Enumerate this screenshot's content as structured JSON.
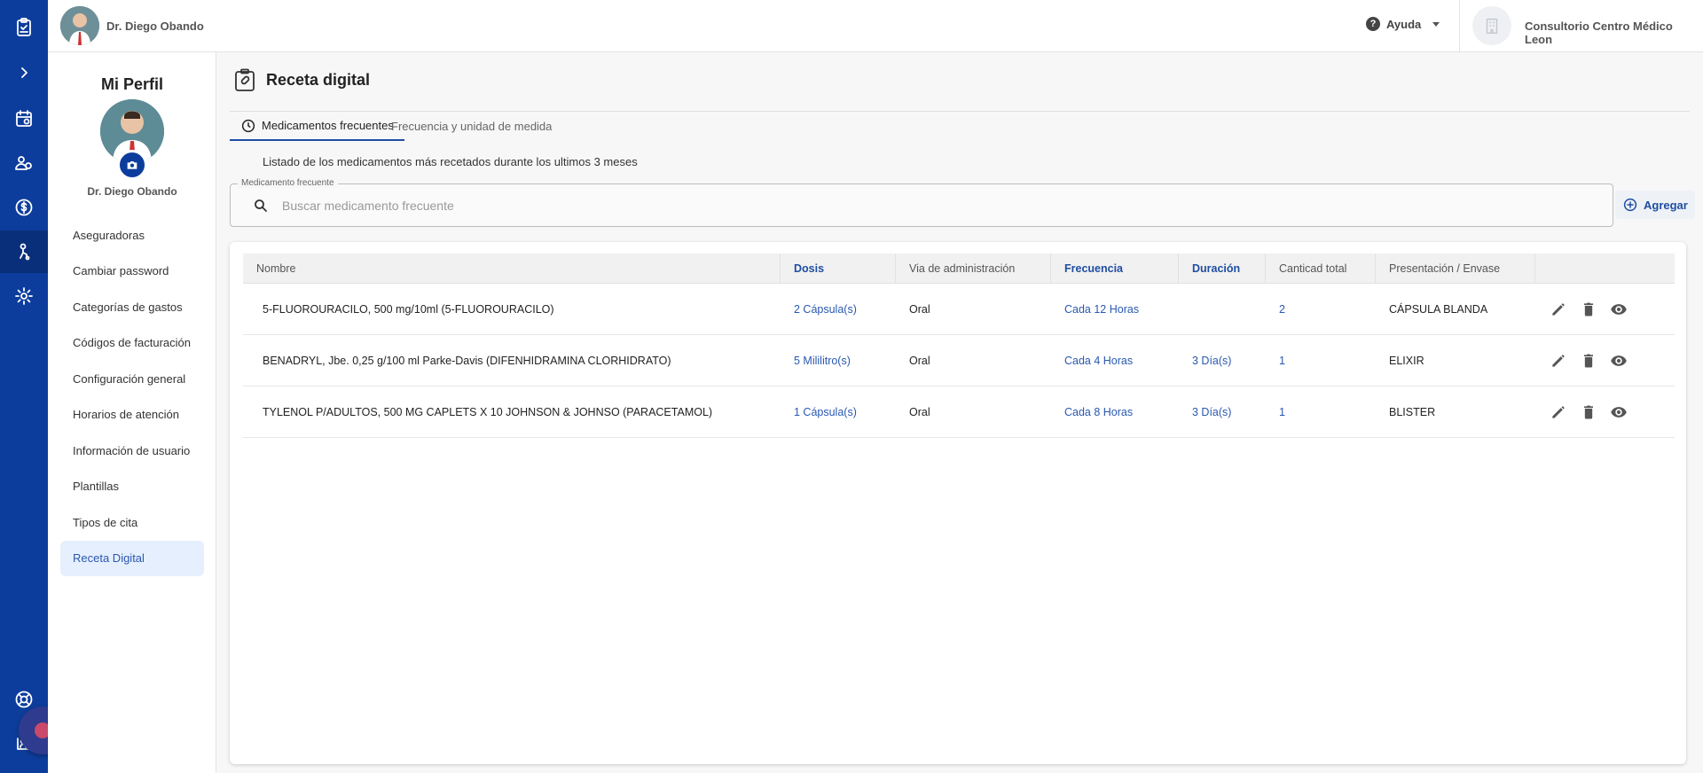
{
  "topbar": {
    "user_name": "Dr. Diego Obando",
    "help_label": "Ayuda",
    "clinic_name": "Consultorio Centro Médico Leon"
  },
  "profile": {
    "title": "Mi Perfil",
    "name": "Dr. Diego Obando",
    "menu": [
      "Aseguradoras",
      "Cambiar password",
      "Categorías de gastos",
      "Códigos de facturación",
      "Configuración general",
      "Horarios de atención",
      "Información de usuario",
      "Plantillas",
      "Tipos de cita",
      "Receta Digital"
    ]
  },
  "page": {
    "title": "Receta digital",
    "tabs": [
      "Medicamentos frecuentes",
      "Frecuencia y unidad de medida"
    ],
    "subtitle": "Listado de los medicamentos más recetados durante los ultimos 3 meses",
    "search_label": "Medicamento frecuente",
    "search_placeholder": "Buscar medicamento frecuente",
    "add_label": "Agregar"
  },
  "table": {
    "headers": [
      "Nombre",
      "Dosis",
      "Via de administración",
      "Frecuencia",
      "Duración",
      "Canticad total",
      "Presentación / Envase"
    ],
    "rows": [
      [
        "5-FLUOROURACILO, 500 mg/10ml (5-FLUOROURACILO)",
        "2 Cápsula(s)",
        "Oral",
        "Cada 12 Horas",
        "",
        "2",
        "CÁPSULA BLANDA"
      ],
      [
        "BENADRYL, Jbe. 0,25 g/100 ml Parke-Davis (DIFENHIDRAMINA CLORHIDRATO)",
        "5 Mililitro(s)",
        "Oral",
        "Cada 4 Horas",
        "3 Día(s)",
        "1",
        "ELIXIR"
      ],
      [
        "TYLENOL P/ADULTOS, 500 MG CAPLETS X 10 JOHNSON & JOHNSO (PARACETAMOL)",
        "1 Cápsula(s)",
        "Oral",
        "Cada 8 Horas",
        "3 Día(s)",
        "1",
        "BLISTER"
      ]
    ]
  },
  "colors": {
    "rail": "#0d3d9c",
    "accent": "#1f4ea3",
    "active_menu_bg": "#e6effd"
  }
}
